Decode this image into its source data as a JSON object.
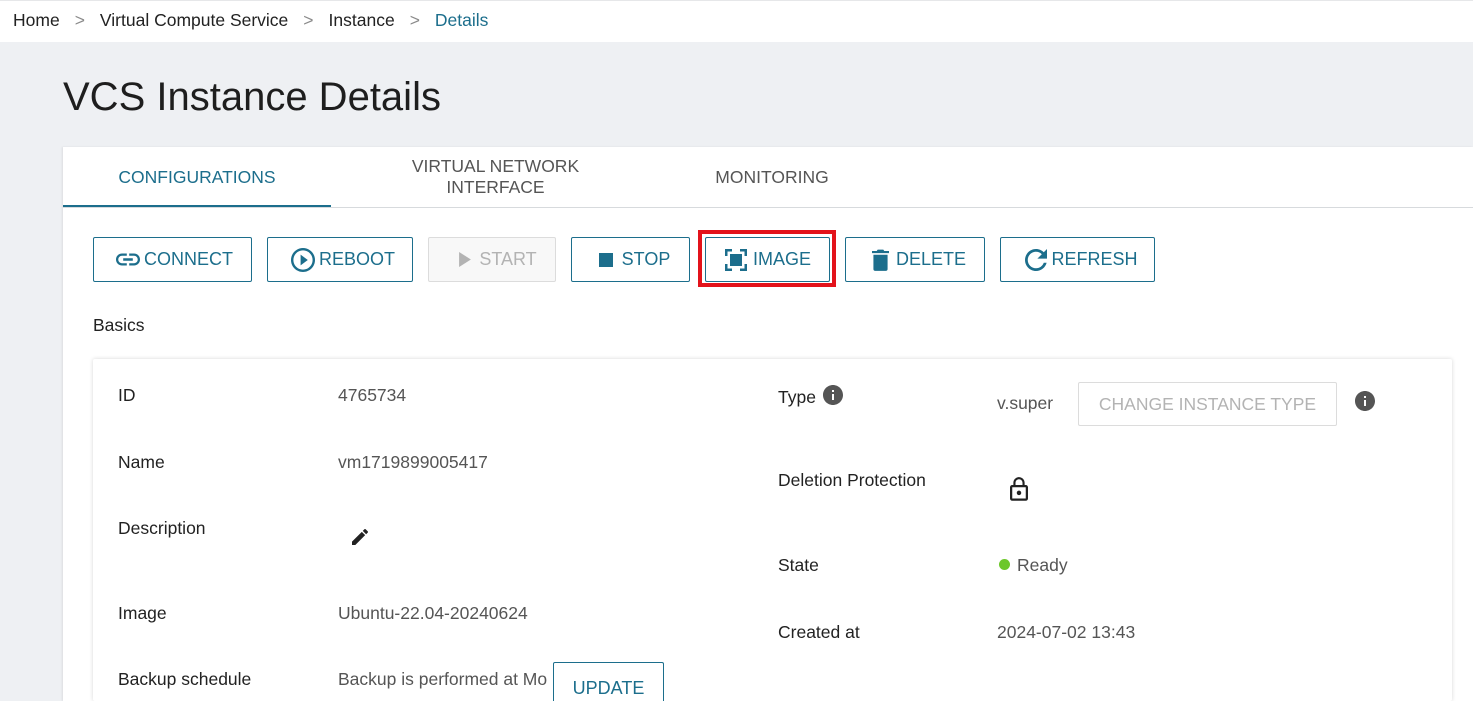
{
  "breadcrumb": {
    "separator": ">",
    "items": [
      "Home",
      "Virtual Compute Service",
      "Instance",
      "Details"
    ]
  },
  "page_title": "VCS Instance Details",
  "tabs": [
    {
      "label": "CONFIGURATIONS",
      "active": true
    },
    {
      "label": "VIRTUAL NETWORK INTERFACE",
      "active": false
    },
    {
      "label": "MONITORING",
      "active": false
    }
  ],
  "toolbar": {
    "buttons": [
      {
        "label": "CONNECT",
        "icon": "link-icon",
        "enabled": true
      },
      {
        "label": "REBOOT",
        "icon": "play-circle-icon",
        "enabled": true
      },
      {
        "label": "START",
        "icon": "play-icon",
        "enabled": false
      },
      {
        "label": "STOP",
        "icon": "stop-icon",
        "enabled": true
      },
      {
        "label": "IMAGE",
        "icon": "image-capture-icon",
        "enabled": true,
        "highlighted": true
      },
      {
        "label": "DELETE",
        "icon": "trash-icon",
        "enabled": true
      },
      {
        "label": "REFRESH",
        "icon": "refresh-icon",
        "enabled": true
      }
    ]
  },
  "basics": {
    "title": "Basics",
    "id": {
      "label": "ID",
      "value": "4765734"
    },
    "name": {
      "label": "Name",
      "value": "vm1719899005417"
    },
    "description": {
      "label": "Description",
      "edit_icon": "pencil-icon"
    },
    "image": {
      "label": "Image",
      "value": "Ubuntu-22.04-20240624"
    },
    "backup_schedule": {
      "label": "Backup schedule",
      "value": "Backup is performed at Mo",
      "action_label": "UPDATE"
    },
    "type": {
      "label": "Type",
      "value": "v.super",
      "info_icon": "info-icon",
      "action_label": "CHANGE INSTANCE TYPE",
      "action_enabled": false
    },
    "deletion_protection": {
      "label": "Deletion Protection",
      "icon": "lock-icon"
    },
    "state": {
      "label": "State",
      "value": "Ready",
      "status_color": "#6cc72a"
    },
    "created_at": {
      "label": "Created at",
      "value": "2024-07-02 13:43"
    }
  },
  "theme": {
    "accent": "#1c6e8c",
    "highlight": "#e3131b",
    "page_background": "#eef0f3",
    "disabled_text": "#b3b3b3"
  }
}
